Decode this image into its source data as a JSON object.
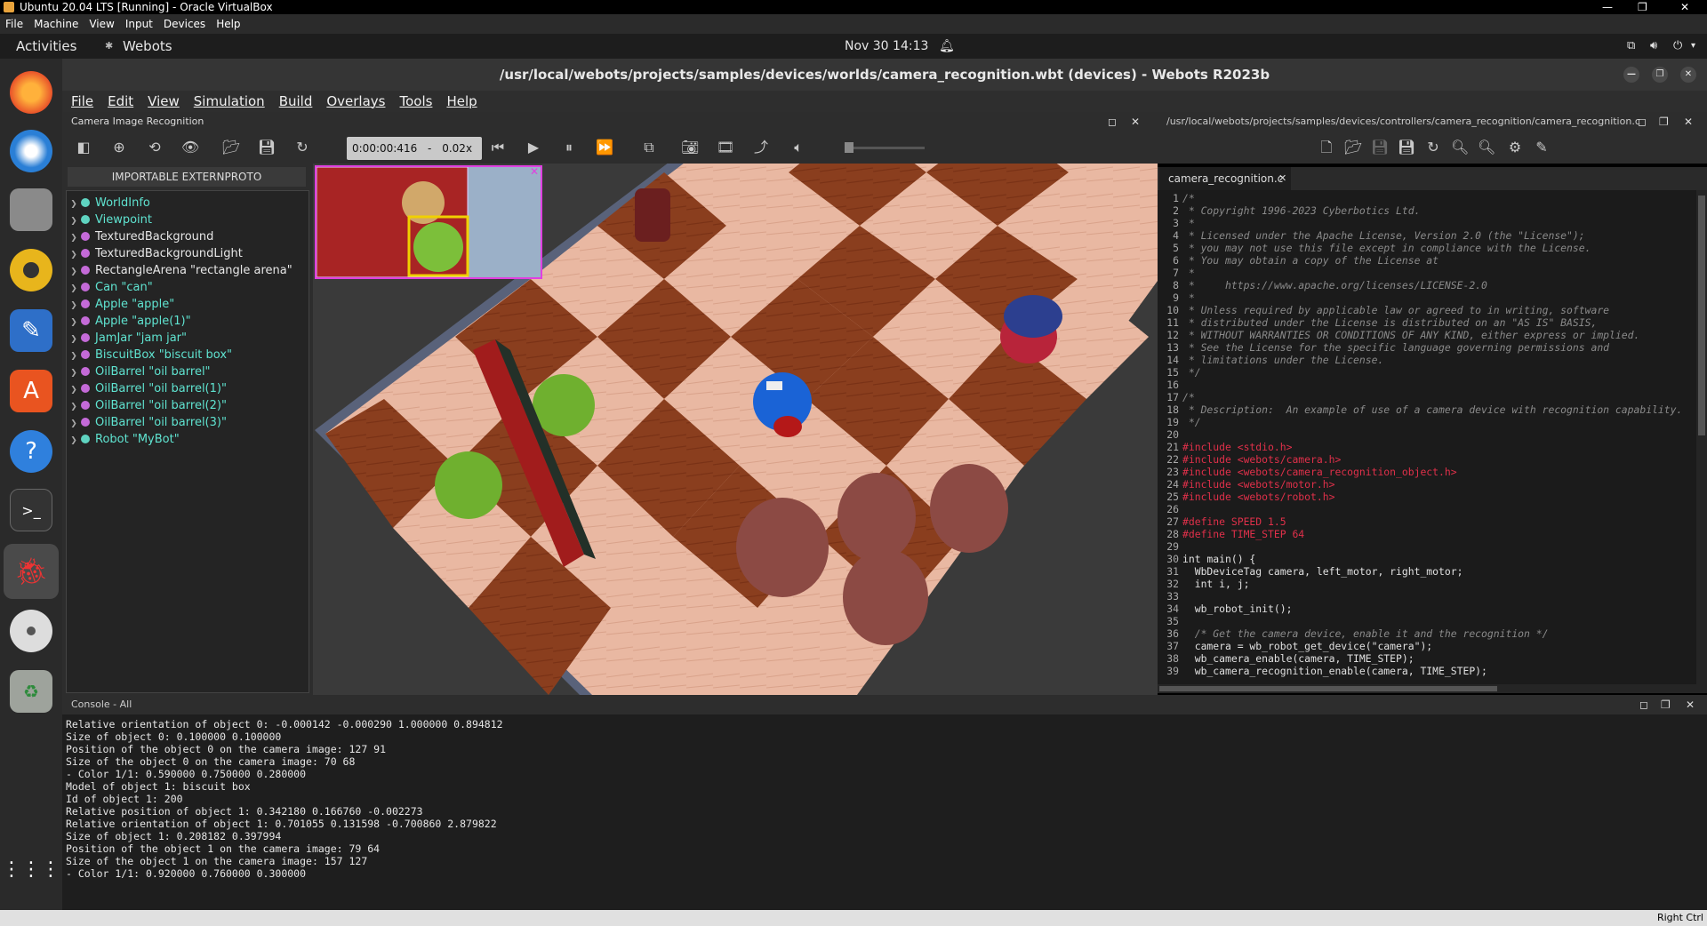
{
  "host": {
    "title": "Ubuntu 20.04 LTS [Running] - Oracle VirtualBox",
    "menu": [
      "File",
      "Machine",
      "View",
      "Input",
      "Devices",
      "Help"
    ],
    "host_key": "Right Ctrl"
  },
  "topbar": {
    "activities": "Activities",
    "app_name": "Webots",
    "clock": "Nov 30  14:13"
  },
  "window": {
    "title": "/usr/local/webots/projects/samples/devices/worlds/camera_recognition.wbt (devices) - Webots R2023b",
    "menu": [
      "File",
      "Edit",
      "View",
      "Simulation",
      "Build",
      "Overlays",
      "Tools",
      "Help"
    ]
  },
  "scene": {
    "panel_title": "Camera Image Recognition",
    "time": "0:00:00:416",
    "speed": "0.02x",
    "proto_button": "IMPORTABLE EXTERNPROTO",
    "tree": [
      {
        "label": "WorldInfo",
        "color": "#5fd3c0",
        "accent": true
      },
      {
        "label": "Viewpoint",
        "color": "#5fd3c0",
        "accent": true
      },
      {
        "label": "TexturedBackground",
        "color": "#c46ad8",
        "accent": false
      },
      {
        "label": "TexturedBackgroundLight",
        "color": "#c46ad8",
        "accent": false
      },
      {
        "label": "RectangleArena \"rectangle arena\"",
        "color": "#c46ad8",
        "accent": false
      },
      {
        "label": "Can \"can\"",
        "color": "#c46ad8",
        "accent": true
      },
      {
        "label": "Apple \"apple\"",
        "color": "#c46ad8",
        "accent": true
      },
      {
        "label": "Apple \"apple(1)\"",
        "color": "#c46ad8",
        "accent": true
      },
      {
        "label": "JamJar \"jam jar\"",
        "color": "#c46ad8",
        "accent": true
      },
      {
        "label": "BiscuitBox \"biscuit box\"",
        "color": "#c46ad8",
        "accent": true
      },
      {
        "label": "OilBarrel \"oil barrel\"",
        "color": "#c46ad8",
        "accent": true
      },
      {
        "label": "OilBarrel \"oil barrel(1)\"",
        "color": "#c46ad8",
        "accent": true
      },
      {
        "label": "OilBarrel \"oil barrel(2)\"",
        "color": "#c46ad8",
        "accent": true
      },
      {
        "label": "OilBarrel \"oil barrel(3)\"",
        "color": "#c46ad8",
        "accent": true
      },
      {
        "label": "Robot \"MyBot\"",
        "color": "#5fd3c0",
        "accent": true
      }
    ]
  },
  "editor": {
    "path": "/usr/local/webots/projects/samples/devices/controllers/camera_recognition/camera_recognition.c",
    "tab": "camera_recognition.c",
    "lines": [
      {
        "n": "1",
        "t": "/*",
        "c": "cm"
      },
      {
        "n": "2",
        "t": " * Copyright 1996-2023 Cyberbotics Ltd.",
        "c": "cm"
      },
      {
        "n": "3",
        "t": " *",
        "c": "cm"
      },
      {
        "n": "4",
        "t": " * Licensed under the Apache License, Version 2.0 (the \"License\");",
        "c": "cm"
      },
      {
        "n": "5",
        "t": " * you may not use this file except in compliance with the License.",
        "c": "cm"
      },
      {
        "n": "6",
        "t": " * You may obtain a copy of the License at",
        "c": "cm"
      },
      {
        "n": "7",
        "t": " *",
        "c": "cm"
      },
      {
        "n": "8",
        "t": " *     https://www.apache.org/licenses/LICENSE-2.0",
        "c": "cm"
      },
      {
        "n": "9",
        "t": " *",
        "c": "cm"
      },
      {
        "n": "10",
        "t": " * Unless required by applicable law or agreed to in writing, software",
        "c": "cm"
      },
      {
        "n": "11",
        "t": " * distributed under the License is distributed on an \"AS IS\" BASIS,",
        "c": "cm"
      },
      {
        "n": "12",
        "t": " * WITHOUT WARRANTIES OR CONDITIONS OF ANY KIND, either express or implied.",
        "c": "cm"
      },
      {
        "n": "13",
        "t": " * See the License for the specific language governing permissions and",
        "c": "cm"
      },
      {
        "n": "14",
        "t": " * limitations under the License.",
        "c": "cm"
      },
      {
        "n": "15",
        "t": " */",
        "c": "cm"
      },
      {
        "n": "16",
        "t": "",
        "c": "nm"
      },
      {
        "n": "17",
        "t": "/*",
        "c": "cm"
      },
      {
        "n": "18",
        "t": " * Description:  An example of use of a camera device with recognition capability.",
        "c": "cm"
      },
      {
        "n": "19",
        "t": " */",
        "c": "cm"
      },
      {
        "n": "20",
        "t": "",
        "c": "nm"
      },
      {
        "n": "21",
        "t": "#include <stdio.h>",
        "c": "pp"
      },
      {
        "n": "22",
        "t": "#include <webots/camera.h>",
        "c": "pp"
      },
      {
        "n": "23",
        "t": "#include <webots/camera_recognition_object.h>",
        "c": "pp"
      },
      {
        "n": "24",
        "t": "#include <webots/motor.h>",
        "c": "pp"
      },
      {
        "n": "25",
        "t": "#include <webots/robot.h>",
        "c": "pp"
      },
      {
        "n": "26",
        "t": "",
        "c": "nm"
      },
      {
        "n": "27",
        "t": "#define SPEED 1.5",
        "c": "pp"
      },
      {
        "n": "28",
        "t": "#define TIME_STEP 64",
        "c": "pp"
      },
      {
        "n": "29",
        "t": "",
        "c": "nm"
      },
      {
        "n": "30",
        "t": "int main() {",
        "c": "nm"
      },
      {
        "n": "31",
        "t": "  WbDeviceTag camera, left_motor, right_motor;",
        "c": "nm"
      },
      {
        "n": "32",
        "t": "  int i, j;",
        "c": "nm"
      },
      {
        "n": "33",
        "t": "",
        "c": "nm"
      },
      {
        "n": "34",
        "t": "  wb_robot_init();",
        "c": "nm"
      },
      {
        "n": "35",
        "t": "",
        "c": "nm"
      },
      {
        "n": "36",
        "t": "  /* Get the camera device, enable it and the recognition */",
        "c": "cm"
      },
      {
        "n": "37",
        "t": "  camera = wb_robot_get_device(\"camera\");",
        "c": "nm"
      },
      {
        "n": "38",
        "t": "  wb_camera_enable(camera, TIME_STEP);",
        "c": "nm"
      },
      {
        "n": "39",
        "t": "  wb_camera_recognition_enable(camera, TIME_STEP);",
        "c": "nm"
      }
    ]
  },
  "console": {
    "title": "Console - All",
    "lines": [
      "Relative orientation of object 0: -0.000142 -0.000290 1.000000 0.894812",
      "Size of object 0: 0.100000 0.100000",
      "Position of the object 0 on the camera image: 127 91",
      "Size of the object 0 on the camera image: 70 68",
      "- Color 1/1: 0.590000 0.750000 0.280000",
      "Model of object 1: biscuit box",
      "Id of object 1: 200",
      "Relative position of object 1: 0.342180 0.166760 -0.002273",
      "Relative orientation of object 1: 0.701055 0.131598 -0.700860 2.879822",
      "Size of object 1: 0.208182 0.397994",
      "Position of the object 1 on the camera image: 79 64",
      "Size of the object 1 on the camera image: 157 127",
      "- Color 1/1: 0.920000 0.760000 0.300000"
    ]
  }
}
